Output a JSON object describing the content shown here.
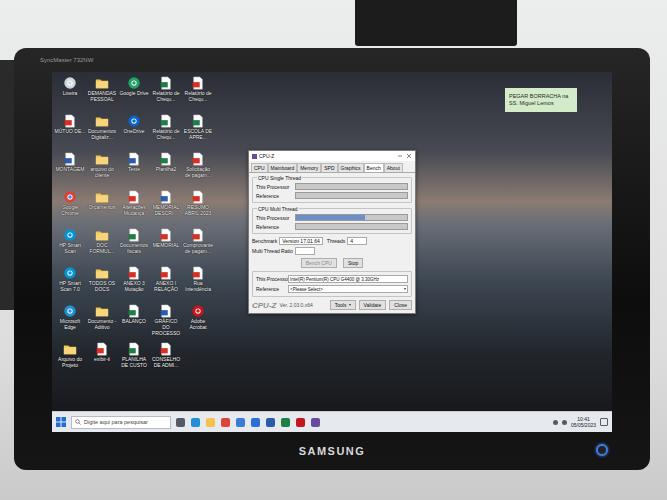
{
  "monitor": {
    "model": "SyncMaster 732NW",
    "brand": "SAMSUNG",
    "power_on": true
  },
  "desktop": {
    "icons": [
      {
        "label": "Lixeira",
        "kind": "recycle"
      },
      {
        "label": "DEMANDAS PESSOAL",
        "kind": "folder"
      },
      {
        "label": "Google Drive",
        "kind": "drive"
      },
      {
        "label": "Relatório de Chequ...",
        "kind": "excel"
      },
      {
        "label": "Relatório de Chequ...",
        "kind": "pdf"
      },
      {
        "label": "MÚTUO DE...",
        "kind": "pdf"
      },
      {
        "label": "Documentos Digitaliz...",
        "kind": "folder"
      },
      {
        "label": "OneDrive",
        "kind": "onedrive"
      },
      {
        "label": "Relatório de Chequ...",
        "kind": "excel"
      },
      {
        "label": "ESCOLA DE APRE...",
        "kind": "excel"
      },
      {
        "label": "MONTAGEM",
        "kind": "word"
      },
      {
        "label": "arquivo do cliente",
        "kind": "folder"
      },
      {
        "label": "Teste",
        "kind": "word"
      },
      {
        "label": "Planilha2",
        "kind": "excel"
      },
      {
        "label": "Solicitação de pagam...",
        "kind": "pdf"
      },
      {
        "label": "Google Chrome",
        "kind": "chrome"
      },
      {
        "label": "Orçamentos",
        "kind": "folder"
      },
      {
        "label": "Alterações Mudança",
        "kind": "pdf"
      },
      {
        "label": "MEMORIAL DESCRI...",
        "kind": "word"
      },
      {
        "label": "RESUMO ABRIL 2023",
        "kind": "pdf"
      },
      {
        "label": "HP Smart Scan",
        "kind": "hp"
      },
      {
        "label": "DOC FORMUL...",
        "kind": "folder"
      },
      {
        "label": "Documentos fiscais",
        "kind": "excel"
      },
      {
        "label": "MEMORIAL",
        "kind": "pdf"
      },
      {
        "label": "Comprovante de pagam...",
        "kind": "pdf"
      },
      {
        "label": "HP Smart Scan 7.0",
        "kind": "hp"
      },
      {
        "label": "TODOS OS DOCS",
        "kind": "folder"
      },
      {
        "label": "ANEXO 3 Mutação",
        "kind": "pdf"
      },
      {
        "label": "ANEXO I RELAÇÃO",
        "kind": "pdf"
      },
      {
        "label": "Rua Intendência",
        "kind": "pdf"
      },
      {
        "label": "Microsoft Edge",
        "kind": "edge"
      },
      {
        "label": "Documento - Aditivo",
        "kind": "folder"
      },
      {
        "label": "BALANÇO",
        "kind": "excel"
      },
      {
        "label": "GRÁFICO DO PROCESSO",
        "kind": "word"
      },
      {
        "label": "Adobe Acrobat",
        "kind": "acrobat"
      },
      {
        "label": "Arquivo do Projeto",
        "kind": "folder"
      },
      {
        "label": "exibir-ii",
        "kind": "pdf"
      },
      {
        "label": "PLANILHA DE CUSTO",
        "kind": "excel"
      },
      {
        "label": "CONSELHO DE ADMI...",
        "kind": "pdf"
      }
    ]
  },
  "sticky_note": {
    "text": "PEGAR BORRACHA na SS. Miguel Lemos"
  },
  "cpuz": {
    "title": "CPU-Z",
    "tabs": [
      {
        "label": "CPU",
        "selected": false
      },
      {
        "label": "Mainboard",
        "selected": false
      },
      {
        "label": "Memory",
        "selected": false
      },
      {
        "label": "SPD",
        "selected": false
      },
      {
        "label": "Graphics",
        "selected": false
      },
      {
        "label": "Bench",
        "selected": true
      },
      {
        "label": "About",
        "selected": false
      }
    ],
    "groups": [
      {
        "title": "CPU Single Thread",
        "bars": [
          {
            "label": "This Processor",
            "level": 0.0
          },
          {
            "label": "Reference",
            "level": 0.0
          }
        ]
      },
      {
        "title": "CPU Multi Thread",
        "bars": [
          {
            "label": "This Processor",
            "level": 0.62
          },
          {
            "label": "Reference",
            "level": 0.0
          }
        ]
      }
    ],
    "fields": [
      {
        "label": "Benchmark",
        "value": "Version 17.01.64"
      },
      {
        "label": "Threads",
        "value": "4"
      },
      {
        "label": "Multi Thread Ratio",
        "value": ""
      }
    ],
    "actions": [
      {
        "label": "Bench CPU",
        "disabled": true
      },
      {
        "label": "Stop",
        "disabled": false
      }
    ],
    "compare": [
      {
        "label": "This Processor",
        "value": "Intel(R) Pentium(R) CPU G4400 @ 3.30GHz",
        "kind": "text"
      },
      {
        "label": "Reference",
        "value": "<Please Select>",
        "kind": "dropdown"
      }
    ],
    "footer": {
      "logo": "CPU-Z",
      "version": "Ver. 2.03.0.x64",
      "buttons": [
        {
          "label": "Tools",
          "kind": "dropdown"
        },
        {
          "label": "Validate",
          "kind": "button"
        },
        {
          "label": "Close",
          "kind": "button"
        }
      ]
    }
  },
  "taskbar": {
    "search_placeholder": "Digite aqui para pesquisar",
    "pinned": [
      {
        "kind": "taskview"
      },
      {
        "kind": "edge"
      },
      {
        "kind": "explorer"
      },
      {
        "kind": "chrome"
      },
      {
        "kind": "store"
      },
      {
        "kind": "mail"
      },
      {
        "kind": "word"
      },
      {
        "kind": "excel"
      },
      {
        "kind": "acrobat"
      },
      {
        "kind": "cpuz"
      }
    ],
    "time": "10:41",
    "date": "05/05/2023"
  }
}
